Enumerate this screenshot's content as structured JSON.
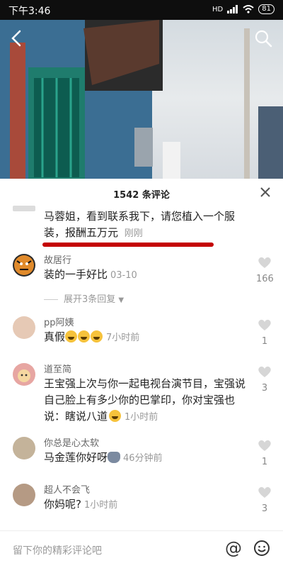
{
  "status": {
    "time": "下午3:46",
    "network": "HD",
    "battery": "81"
  },
  "sheet": {
    "comment_count": "1542 条评论"
  },
  "pinned": {
    "text": "马蓉姐，看到联系我下，请您植入一个服装，报酬五万元",
    "time": "刚刚"
  },
  "comments": [
    {
      "user": "故居行",
      "text": "装的一手好比",
      "time": "03-10",
      "likes": "166",
      "replies": "展开3条回复"
    },
    {
      "user": "pp阿姨",
      "text": "真假",
      "emoji_count": 3,
      "time": "7小时前",
      "likes": "1"
    },
    {
      "user": "道至简",
      "text": "王宝强上次与你一起电视台演节目，宝强说自己脸上有多少你的巴掌印，你对宝强也说：瞎说八道",
      "time": "1小时前",
      "likes": "3"
    },
    {
      "user": "你总是心太软",
      "text": "马金莲你好呀",
      "time": "46分钟前",
      "likes": "1"
    },
    {
      "user": "超人不会飞",
      "text": "你妈呢?",
      "time": "1小时前",
      "likes": "3"
    }
  ],
  "input": {
    "placeholder": "留下你的精彩评论吧"
  },
  "icons": {
    "back": "back-arrow-icon",
    "search": "search-icon",
    "close": "close-icon",
    "like": "heart-icon",
    "at": "at-icon",
    "emoji": "emoji-icon"
  }
}
